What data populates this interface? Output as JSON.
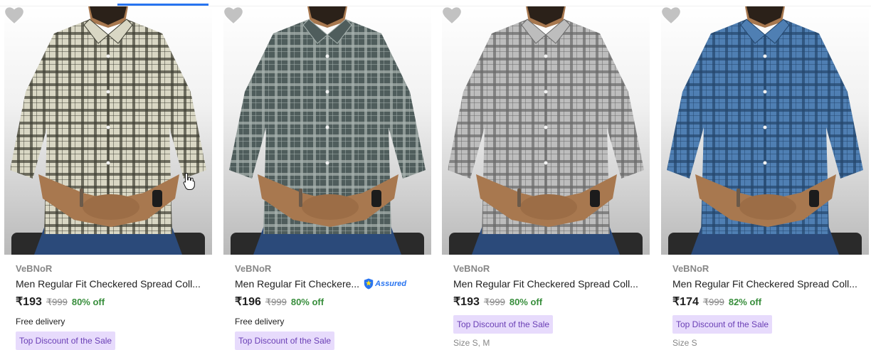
{
  "colors": {
    "accent": "#2874f0",
    "discount_green": "#388e3c",
    "badge_bg": "#e7dbfc",
    "badge_text": "#6a3fb5",
    "muted": "#878787"
  },
  "products": [
    {
      "brand": "VeBNoR",
      "title": "Men Regular Fit Checkered Spread Coll...",
      "price": "₹193",
      "mrp": "₹999",
      "discount": "80% off",
      "delivery": "Free delivery",
      "badge": "Top Discount of the Sale",
      "assured": false,
      "sizes": "",
      "shirt_color": "#d9d7c4",
      "check_color": "#3f3f34"
    },
    {
      "brand": "VeBNoR",
      "title": "Men Regular Fit Checkere...",
      "assured_label": "Assured",
      "price": "₹196",
      "mrp": "₹999",
      "discount": "80% off",
      "delivery": "Free delivery",
      "badge": "Top Discount of the Sale",
      "assured": true,
      "sizes": "",
      "shirt_color": "#4f5d5c",
      "check_color": "#a8b3b0"
    },
    {
      "brand": "VeBNoR",
      "title": "Men Regular Fit Checkered Spread Coll...",
      "price": "₹193",
      "mrp": "₹999",
      "discount": "80% off",
      "delivery": "",
      "badge": "Top Discount of the Sale",
      "assured": false,
      "sizes": "Size S, M",
      "shirt_color": "#bdbdbd",
      "check_color": "#6a6a6a"
    },
    {
      "brand": "VeBNoR",
      "title": "Men Regular Fit Checkered Spread Coll...",
      "price": "₹174",
      "mrp": "₹999",
      "discount": "82% off",
      "delivery": "",
      "badge": "Top Discount of the Sale",
      "assured": false,
      "sizes": "Size S",
      "shirt_color": "#4f7fb3",
      "check_color": "#23466d"
    }
  ]
}
